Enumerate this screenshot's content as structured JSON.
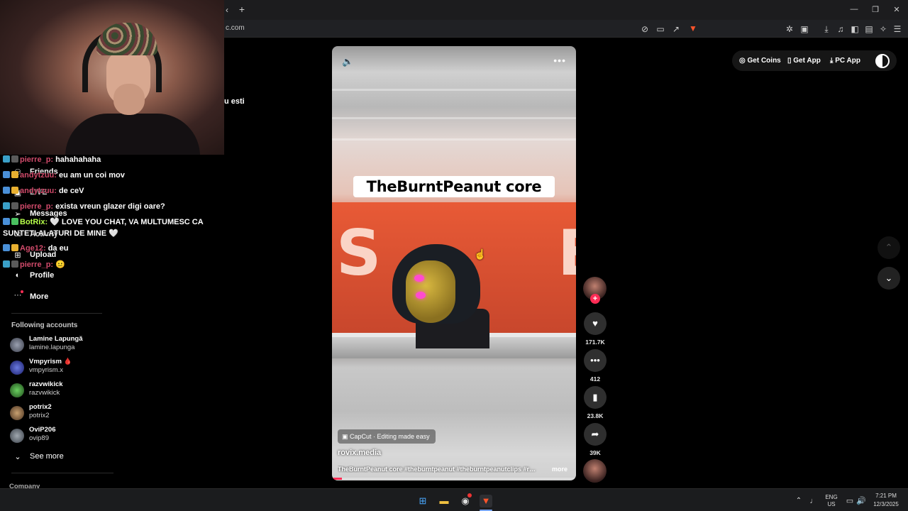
{
  "browser": {
    "url": "c.com",
    "new_tab_label": "+",
    "tab_back": "‹",
    "window": {
      "minimize": "—",
      "restore": "❐",
      "close": "✕"
    }
  },
  "chat": [
    {
      "user": "pierre_p:",
      "message": "hahahahaha",
      "color": "#d04a6a"
    },
    {
      "user": "andytzuu:",
      "message": "eu am un coi mov",
      "color": "#d04a6a"
    },
    {
      "user": "andytzuu:",
      "message": "de ceV",
      "color": "#d04a6a"
    },
    {
      "user": "pierre_p:",
      "message": "exista vreun glazer digi oare?",
      "color": "#d04a6a"
    },
    {
      "user": "BotRix:",
      "message": "🤍 LOVE YOU CHAT, VA MULTUMESC CA",
      "message2": "SUNTETI ALATURI DE MINE 🤍",
      "color": "#b8ff4a"
    },
    {
      "user": "Age12:",
      "message": "da eu",
      "color": "#d04a6a"
    },
    {
      "user": "pierre_p:",
      "message": "😐",
      "color": "#d04a6a"
    }
  ],
  "partial_text": "u esti",
  "sidebar": {
    "items": [
      {
        "label": "Friends",
        "icon": "friends-icon"
      },
      {
        "label": "LIVE",
        "icon": "live-icon"
      },
      {
        "label": "Messages",
        "icon": "messages-icon"
      },
      {
        "label": "Activity",
        "icon": "activity-icon"
      },
      {
        "label": "Upload",
        "icon": "upload-icon"
      },
      {
        "label": "Profile",
        "icon": "profile-icon"
      },
      {
        "label": "More",
        "icon": "more-icon"
      }
    ],
    "following_title": "Following accounts",
    "accounts": [
      {
        "name": "Lamine Lapungă",
        "handle": "lamine.lapunga"
      },
      {
        "name": "Vmpyrism 🩸",
        "handle": "vmpyrism.x"
      },
      {
        "name": "razvwikick",
        "handle": "razvwikick"
      },
      {
        "name": "potrix2",
        "handle": "potrix2"
      },
      {
        "name": "OviP206",
        "handle": "ovip89"
      }
    ],
    "see_more": "See more",
    "company": "Company"
  },
  "video": {
    "caption_overlay": "TheBurntPeanut core",
    "capcut": "CapCut · Editing made easy",
    "author": "rovix.media",
    "description": "TheBurntPeanut core #theburntpeanut #theburntpeanutclips #rovix #fyp",
    "more": "more",
    "progress": 0.04
  },
  "actions": {
    "likes": "171.7K",
    "comments": "412",
    "saves": "23.8K",
    "shares": "39K"
  },
  "top_actions": {
    "get_coins": "Get Coins",
    "get_app": "Get App",
    "pc_app": "PC App"
  },
  "taskbar": {
    "lang": "ENG",
    "region": "US",
    "time": "7:21 PM",
    "date": "12/3/2025"
  },
  "colors": {
    "accent": "#fe2c55",
    "bg": "#000000"
  }
}
